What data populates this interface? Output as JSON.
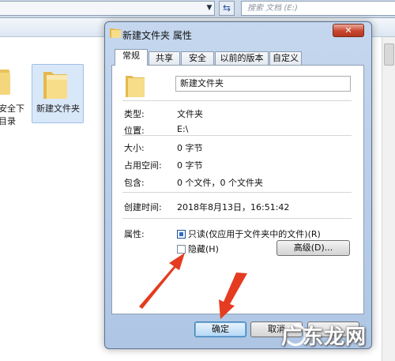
{
  "explorer": {
    "search_placeholder": "搜索 文档 (E:)",
    "left_folder_label_line1": "安全下",
    "left_folder_label_line2": "目录",
    "selected_folder_label": "新建文件夹"
  },
  "dialog": {
    "title": "新建文件夹 属性",
    "close_glyph": "✕",
    "tabs": [
      "常规",
      "共享",
      "安全",
      "以前的版本",
      "自定义"
    ],
    "name_value": "新建文件夹",
    "props": [
      {
        "key": "类型:",
        "value": "文件夹"
      },
      {
        "key": "位置:",
        "value": "E:\\"
      },
      {
        "key": "大小:",
        "value": "0 字节"
      },
      {
        "key": "占用空间:",
        "value": "0 字节"
      },
      {
        "key": "包含:",
        "value": "0 个文件，0 个文件夹"
      }
    ],
    "created": {
      "key": "创建时间:",
      "value": "2018年8月13日，16:51:42"
    },
    "attributes_label": "属性:",
    "readonly_label": "只读(仅应用于文件夹中的文件)(R)",
    "hidden_label": "隐藏(H)",
    "advanced_button": "高级(D)...",
    "ok_button": "确定",
    "cancel_button": "取消",
    "readonly_checked": true,
    "hidden_checked": false
  },
  "watermark": "广东龙网",
  "colors": {
    "arrow": "#e53b20",
    "accent": "#2e6bc6"
  }
}
